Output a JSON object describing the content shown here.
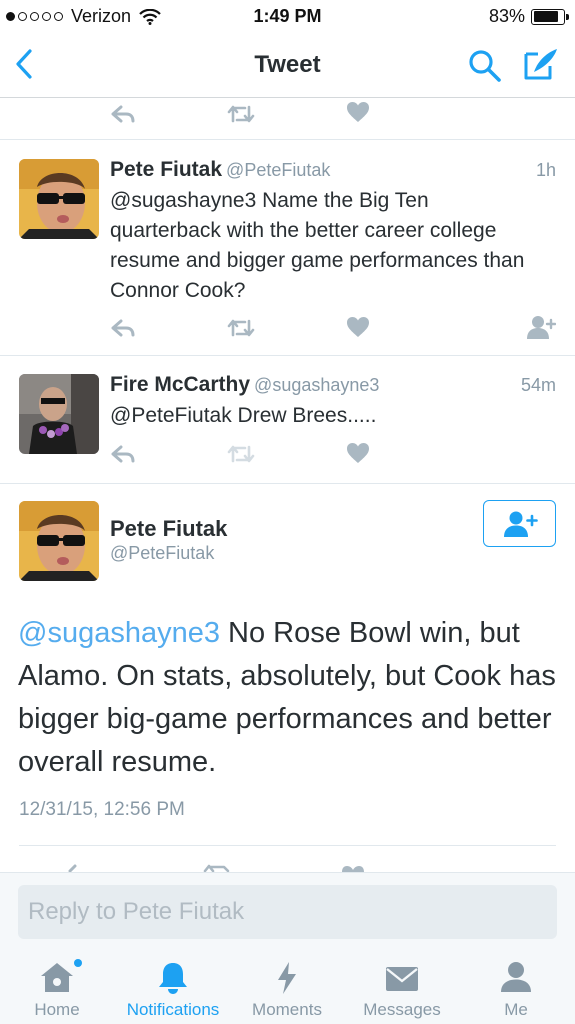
{
  "status_bar": {
    "carrier": "Verizon",
    "signal_bars_filled": 1,
    "signal_bars_total": 5,
    "time": "1:49 PM",
    "battery_percent_label": "83%",
    "battery_level": 0.83
  },
  "nav": {
    "title": "Tweet",
    "back_icon": "chevron-left-icon",
    "search_icon": "search-icon",
    "compose_icon": "compose-icon"
  },
  "replies": [
    {
      "name": "Pete Fiutak",
      "handle": "@PeteFiutak",
      "time": "1h",
      "text": "@sugashayne3 Name the Big Ten quarterback with the better career college resume and bigger game performances than Connor Cook?"
    },
    {
      "name": "Fire McCarthy",
      "handle": "@sugashayne3",
      "time": "54m",
      "text": "@PeteFiutak Drew Brees....."
    }
  ],
  "main_tweet": {
    "name": "Pete Fiutak",
    "handle": "@PeteFiutak",
    "mention": "@sugashayne3",
    "text": " No Rose Bowl win, but Alamo. On stats, absolutely, but Cook has bigger big-game performances and better overall resume.",
    "date": "12/31/15, 12:56 PM"
  },
  "reply_bar": {
    "placeholder": "Reply to Pete Fiutak"
  },
  "tabs": [
    {
      "label": "Home",
      "icon": "home-icon",
      "active": false
    },
    {
      "label": "Notifications",
      "icon": "bell-icon",
      "active": true
    },
    {
      "label": "Moments",
      "icon": "lightning-icon",
      "active": false
    },
    {
      "label": "Messages",
      "icon": "envelope-icon",
      "active": false
    },
    {
      "label": "Me",
      "icon": "person-icon",
      "active": false
    }
  ],
  "colors": {
    "accent": "#1da1f2",
    "mention": "#55acee",
    "muted": "#8899a6",
    "icon_gray": "#aab8c2"
  }
}
